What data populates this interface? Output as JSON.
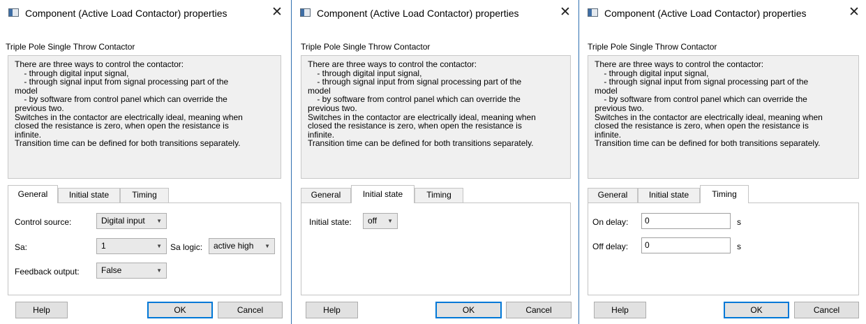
{
  "dialog_title": "Component (Active Load Contactor) properties",
  "close_glyph": "✕",
  "subtitle": "Triple Pole Single Throw Contactor",
  "description": "There are three ways to control the contactor:\n    - through digital input signal,\n    - through signal input from signal processing part of the\nmodel\n    - by software from control panel which can override the\nprevious two.\nSwitches in the contactor are electrically ideal, meaning when\nclosed the resistance is zero, when open the resistance is\ninfinite.\nTransition time can be defined for both transitions separately.",
  "tabs": {
    "general": "General",
    "initial_state": "Initial state",
    "timing": "Timing"
  },
  "general": {
    "control_source_label": "Control source:",
    "control_source_value": "Digital input",
    "sa_label": "Sa:",
    "sa_value": "1",
    "sa_logic_label": "Sa logic:",
    "sa_logic_value": "active high",
    "feedback_label": "Feedback output:",
    "feedback_value": "False"
  },
  "initial": {
    "label": "Initial state:",
    "value": "off"
  },
  "timing": {
    "on_label": "On delay:",
    "on_value": "0",
    "off_label": "Off delay:",
    "off_value": "0",
    "unit": "s"
  },
  "buttons": {
    "help": "Help",
    "ok": "OK",
    "cancel": "Cancel"
  },
  "arrow_glyph": "▼",
  "colors": {
    "separator": "#2e6fb0",
    "default_button_border": "#0078d7"
  }
}
